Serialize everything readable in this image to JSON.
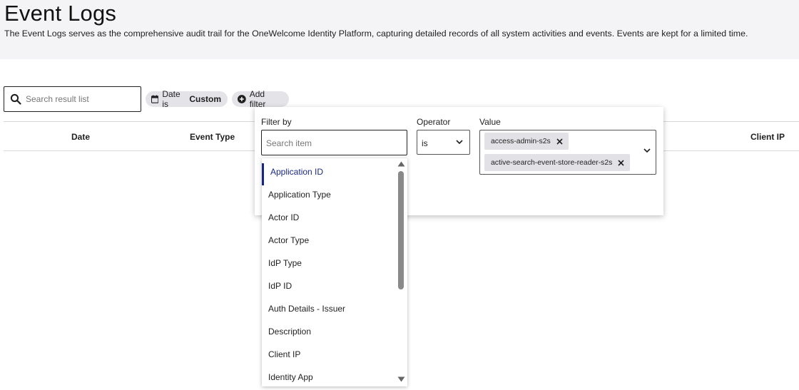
{
  "header": {
    "title": "Event Logs",
    "description": "The Event Logs serves as the comprehensive audit trail for the OneWelcome Identity Platform, capturing detailed records of all system activities and events. Events are kept for a limited time."
  },
  "toolbar": {
    "search_placeholder": "Search result list",
    "date_chip_prefix": "Date is",
    "date_chip_value": "Custom",
    "add_filter_label": "Add filter"
  },
  "table": {
    "columns": [
      "Date",
      "Event Type",
      "Client IP"
    ]
  },
  "filter_panel": {
    "filter_by_label": "Filter by",
    "search_item_placeholder": "Search item",
    "operator_label": "Operator",
    "operator_value": "is",
    "value_label": "Value",
    "value_tags": [
      "access-admin-s2s",
      "active-search-event-store-reader-s2s"
    ]
  },
  "dropdown": {
    "items": [
      "Application ID",
      "Application Type",
      "Actor ID",
      "Actor Type",
      "IdP Type",
      "IdP ID",
      "Auth Details - Issuer",
      "Description",
      "Client IP",
      "Identity App"
    ],
    "active_index": 0
  },
  "colors": {
    "accent": "#15248a",
    "chip_bg": "#e4e4e8",
    "header_bg": "#f4f4f6"
  }
}
